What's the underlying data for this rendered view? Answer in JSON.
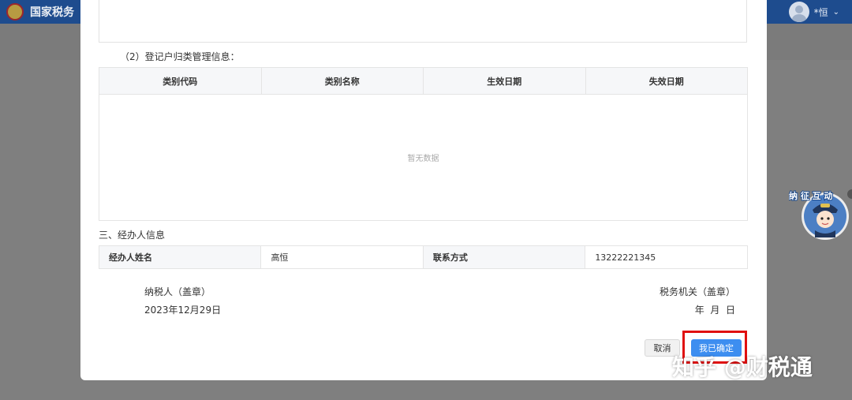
{
  "header": {
    "app_title": "国家税务",
    "user_name": "*恒"
  },
  "section_2": {
    "title": "（2）登记户归类管理信息：",
    "columns": [
      "类别代码",
      "类别名称",
      "生效日期",
      "失效日期"
    ],
    "empty_text": "暂无数据"
  },
  "section_3": {
    "title": "三、经办人信息",
    "name_label": "经办人姓名",
    "name_value": "高恒",
    "contact_label": "联系方式",
    "contact_value": "13222221345"
  },
  "signatures": {
    "taxpayer_label": "纳税人（盖章）",
    "taxpayer_date": "2023年12月29日",
    "authority_label": "税务机关（盖章）",
    "authority_date": "年  月  日"
  },
  "buttons": {
    "cancel": "取消",
    "confirm": "我已确定"
  },
  "widget": {
    "mascot_text": "纳 征 互 动"
  },
  "watermark": "知乎 @财税通"
}
